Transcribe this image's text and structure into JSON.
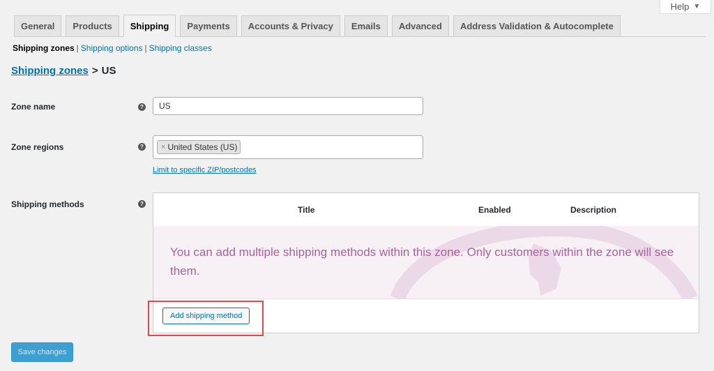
{
  "help": {
    "label": "Help",
    "caret": "▼"
  },
  "tabs": [
    {
      "label": "General"
    },
    {
      "label": "Products"
    },
    {
      "label": "Shipping",
      "active": true
    },
    {
      "label": "Payments"
    },
    {
      "label": "Accounts & Privacy"
    },
    {
      "label": "Emails"
    },
    {
      "label": "Advanced"
    },
    {
      "label": "Address Validation & Autocomplete"
    }
  ],
  "subnav": {
    "current": "Shipping zones",
    "separator": "|",
    "links": [
      "Shipping options",
      "Shipping classes"
    ]
  },
  "breadcrumb": {
    "parent": "Shipping zones",
    "separator": ">",
    "current": "US"
  },
  "form": {
    "zone_name": {
      "label": "Zone name",
      "value": "US"
    },
    "zone_regions": {
      "label": "Zone regions",
      "selected": [
        "United States (US)"
      ],
      "remove_glyph": "×",
      "limit_link": "Limit to specific ZIP/postcodes"
    },
    "shipping_methods": {
      "label": "Shipping methods",
      "columns": [
        "Title",
        "Enabled",
        "Description"
      ],
      "blank_state": "You can add multiple shipping methods within this zone. Only customers within the zone will see them.",
      "add_button": "Add shipping method"
    },
    "help_tip_glyph": "?"
  },
  "save_button": "Save changes",
  "colors": {
    "link": "#0073aa",
    "blank_state_bg": "#f7f1f6",
    "blank_state_text": "#a46497",
    "highlight": "#e2474b",
    "primary_button": "#3e9fd2"
  }
}
